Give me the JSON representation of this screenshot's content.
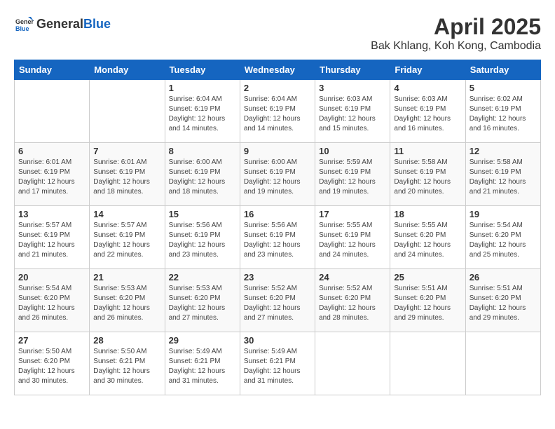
{
  "header": {
    "logo_general": "General",
    "logo_blue": "Blue",
    "month_year": "April 2025",
    "location": "Bak Khlang, Koh Kong, Cambodia"
  },
  "weekdays": [
    "Sunday",
    "Monday",
    "Tuesday",
    "Wednesday",
    "Thursday",
    "Friday",
    "Saturday"
  ],
  "weeks": [
    [
      {
        "day": "",
        "sunrise": "",
        "sunset": "",
        "daylight": ""
      },
      {
        "day": "",
        "sunrise": "",
        "sunset": "",
        "daylight": ""
      },
      {
        "day": "1",
        "sunrise": "Sunrise: 6:04 AM",
        "sunset": "Sunset: 6:19 PM",
        "daylight": "Daylight: 12 hours and 14 minutes."
      },
      {
        "day": "2",
        "sunrise": "Sunrise: 6:04 AM",
        "sunset": "Sunset: 6:19 PM",
        "daylight": "Daylight: 12 hours and 14 minutes."
      },
      {
        "day": "3",
        "sunrise": "Sunrise: 6:03 AM",
        "sunset": "Sunset: 6:19 PM",
        "daylight": "Daylight: 12 hours and 15 minutes."
      },
      {
        "day": "4",
        "sunrise": "Sunrise: 6:03 AM",
        "sunset": "Sunset: 6:19 PM",
        "daylight": "Daylight: 12 hours and 16 minutes."
      },
      {
        "day": "5",
        "sunrise": "Sunrise: 6:02 AM",
        "sunset": "Sunset: 6:19 PM",
        "daylight": "Daylight: 12 hours and 16 minutes."
      }
    ],
    [
      {
        "day": "6",
        "sunrise": "Sunrise: 6:01 AM",
        "sunset": "Sunset: 6:19 PM",
        "daylight": "Daylight: 12 hours and 17 minutes."
      },
      {
        "day": "7",
        "sunrise": "Sunrise: 6:01 AM",
        "sunset": "Sunset: 6:19 PM",
        "daylight": "Daylight: 12 hours and 18 minutes."
      },
      {
        "day": "8",
        "sunrise": "Sunrise: 6:00 AM",
        "sunset": "Sunset: 6:19 PM",
        "daylight": "Daylight: 12 hours and 18 minutes."
      },
      {
        "day": "9",
        "sunrise": "Sunrise: 6:00 AM",
        "sunset": "Sunset: 6:19 PM",
        "daylight": "Daylight: 12 hours and 19 minutes."
      },
      {
        "day": "10",
        "sunrise": "Sunrise: 5:59 AM",
        "sunset": "Sunset: 6:19 PM",
        "daylight": "Daylight: 12 hours and 19 minutes."
      },
      {
        "day": "11",
        "sunrise": "Sunrise: 5:58 AM",
        "sunset": "Sunset: 6:19 PM",
        "daylight": "Daylight: 12 hours and 20 minutes."
      },
      {
        "day": "12",
        "sunrise": "Sunrise: 5:58 AM",
        "sunset": "Sunset: 6:19 PM",
        "daylight": "Daylight: 12 hours and 21 minutes."
      }
    ],
    [
      {
        "day": "13",
        "sunrise": "Sunrise: 5:57 AM",
        "sunset": "Sunset: 6:19 PM",
        "daylight": "Daylight: 12 hours and 21 minutes."
      },
      {
        "day": "14",
        "sunrise": "Sunrise: 5:57 AM",
        "sunset": "Sunset: 6:19 PM",
        "daylight": "Daylight: 12 hours and 22 minutes."
      },
      {
        "day": "15",
        "sunrise": "Sunrise: 5:56 AM",
        "sunset": "Sunset: 6:19 PM",
        "daylight": "Daylight: 12 hours and 23 minutes."
      },
      {
        "day": "16",
        "sunrise": "Sunrise: 5:56 AM",
        "sunset": "Sunset: 6:19 PM",
        "daylight": "Daylight: 12 hours and 23 minutes."
      },
      {
        "day": "17",
        "sunrise": "Sunrise: 5:55 AM",
        "sunset": "Sunset: 6:19 PM",
        "daylight": "Daylight: 12 hours and 24 minutes."
      },
      {
        "day": "18",
        "sunrise": "Sunrise: 5:55 AM",
        "sunset": "Sunset: 6:20 PM",
        "daylight": "Daylight: 12 hours and 24 minutes."
      },
      {
        "day": "19",
        "sunrise": "Sunrise: 5:54 AM",
        "sunset": "Sunset: 6:20 PM",
        "daylight": "Daylight: 12 hours and 25 minutes."
      }
    ],
    [
      {
        "day": "20",
        "sunrise": "Sunrise: 5:54 AM",
        "sunset": "Sunset: 6:20 PM",
        "daylight": "Daylight: 12 hours and 26 minutes."
      },
      {
        "day": "21",
        "sunrise": "Sunrise: 5:53 AM",
        "sunset": "Sunset: 6:20 PM",
        "daylight": "Daylight: 12 hours and 26 minutes."
      },
      {
        "day": "22",
        "sunrise": "Sunrise: 5:53 AM",
        "sunset": "Sunset: 6:20 PM",
        "daylight": "Daylight: 12 hours and 27 minutes."
      },
      {
        "day": "23",
        "sunrise": "Sunrise: 5:52 AM",
        "sunset": "Sunset: 6:20 PM",
        "daylight": "Daylight: 12 hours and 27 minutes."
      },
      {
        "day": "24",
        "sunrise": "Sunrise: 5:52 AM",
        "sunset": "Sunset: 6:20 PM",
        "daylight": "Daylight: 12 hours and 28 minutes."
      },
      {
        "day": "25",
        "sunrise": "Sunrise: 5:51 AM",
        "sunset": "Sunset: 6:20 PM",
        "daylight": "Daylight: 12 hours and 29 minutes."
      },
      {
        "day": "26",
        "sunrise": "Sunrise: 5:51 AM",
        "sunset": "Sunset: 6:20 PM",
        "daylight": "Daylight: 12 hours and 29 minutes."
      }
    ],
    [
      {
        "day": "27",
        "sunrise": "Sunrise: 5:50 AM",
        "sunset": "Sunset: 6:20 PM",
        "daylight": "Daylight: 12 hours and 30 minutes."
      },
      {
        "day": "28",
        "sunrise": "Sunrise: 5:50 AM",
        "sunset": "Sunset: 6:21 PM",
        "daylight": "Daylight: 12 hours and 30 minutes."
      },
      {
        "day": "29",
        "sunrise": "Sunrise: 5:49 AM",
        "sunset": "Sunset: 6:21 PM",
        "daylight": "Daylight: 12 hours and 31 minutes."
      },
      {
        "day": "30",
        "sunrise": "Sunrise: 5:49 AM",
        "sunset": "Sunset: 6:21 PM",
        "daylight": "Daylight: 12 hours and 31 minutes."
      },
      {
        "day": "",
        "sunrise": "",
        "sunset": "",
        "daylight": ""
      },
      {
        "day": "",
        "sunrise": "",
        "sunset": "",
        "daylight": ""
      },
      {
        "day": "",
        "sunrise": "",
        "sunset": "",
        "daylight": ""
      }
    ]
  ]
}
